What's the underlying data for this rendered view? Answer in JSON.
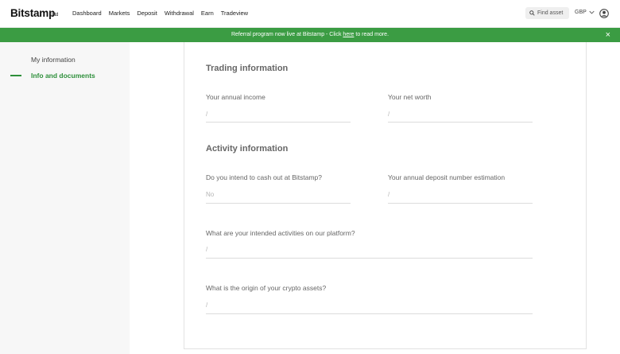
{
  "brand": {
    "name": "Bitstamp",
    "suffix": "Ltd"
  },
  "nav": [
    "Dashboard",
    "Markets",
    "Deposit",
    "Withdrawal",
    "Earn",
    "Tradeview"
  ],
  "search": {
    "placeholder": "Find asset"
  },
  "currency": "GBP",
  "banner": {
    "text_before": "Referral program now live at Bitstamp - Click ",
    "link": "here",
    "text_after": " to read more.",
    "close": "×",
    "color": "#3b9c43"
  },
  "sidebar": {
    "items": [
      {
        "label": "My information"
      },
      {
        "label": "Info and documents"
      }
    ],
    "active_color": "#2d8f3a"
  },
  "trading": {
    "title": "Trading information",
    "annual_income": {
      "label": "Your annual income",
      "value": "/"
    },
    "net_worth": {
      "label": "Your net worth",
      "value": "/"
    }
  },
  "activity": {
    "title": "Activity information",
    "cash_out": {
      "label": "Do you intend to cash out at Bitstamp?",
      "value": "No"
    },
    "deposit_estimation": {
      "label": "Your annual deposit number estimation",
      "value": "/"
    },
    "intended_activities": {
      "label": "What are your intended activities on our platform?",
      "value": "/"
    },
    "crypto_origin": {
      "label": "What is the origin of your crypto assets?",
      "value": "/"
    }
  }
}
